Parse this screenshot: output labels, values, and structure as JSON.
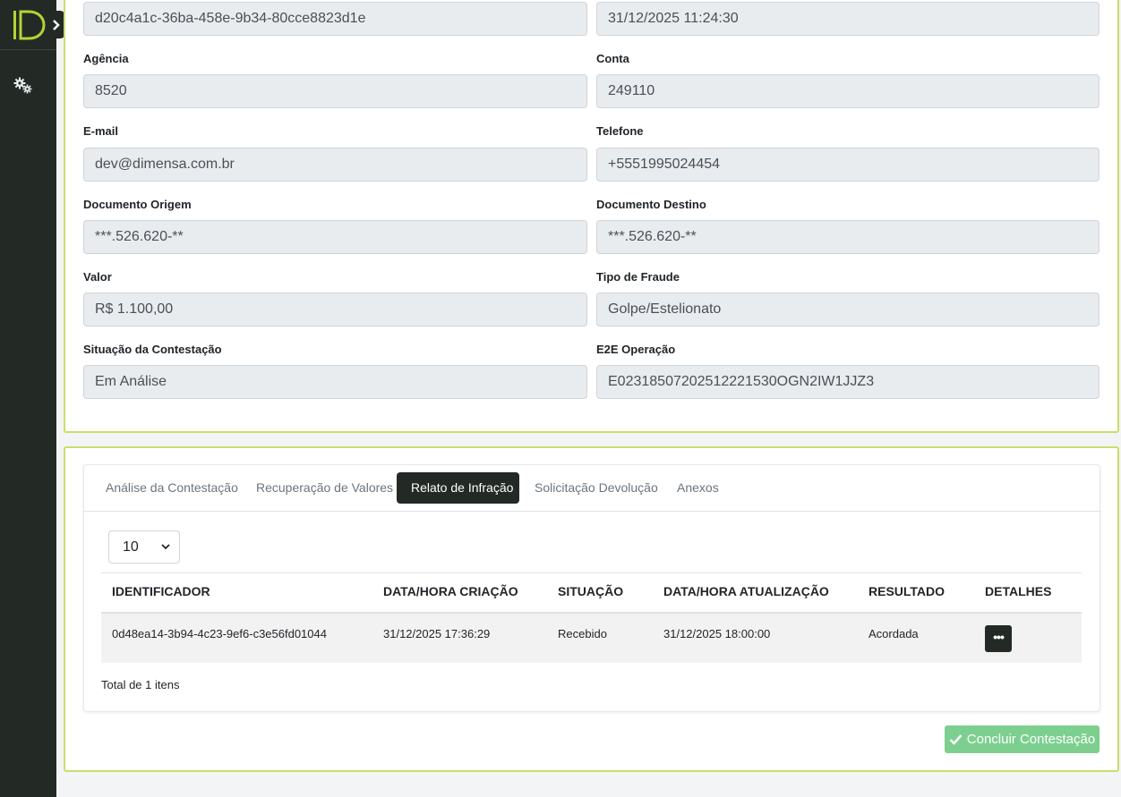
{
  "sidebar": {
    "logo": "D-logo",
    "toggle_icon": "chevron-right-icon",
    "items": [
      {
        "icon": "gears-icon"
      }
    ]
  },
  "contestation": {
    "fields": [
      {
        "id": "identificador",
        "label": "",
        "value": "d20c4a1c-36ba-458e-9b34-80cce8823d1e"
      },
      {
        "id": "data",
        "label": "",
        "value": "31/12/2025 11:24:30"
      },
      {
        "id": "agencia",
        "label": "Agência",
        "value": "8520"
      },
      {
        "id": "conta",
        "label": "Conta",
        "value": "249110"
      },
      {
        "id": "email",
        "label": "E-mail",
        "value": "dev@dimensa.com.br"
      },
      {
        "id": "telefone",
        "label": "Telefone",
        "value": "+5551995024454"
      },
      {
        "id": "doc_origem",
        "label": "Documento Origem",
        "value": "***.526.620-**"
      },
      {
        "id": "doc_destino",
        "label": "Documento Destino",
        "value": "***.526.620-**"
      },
      {
        "id": "valor",
        "label": "Valor",
        "value": "R$ 1.100,00"
      },
      {
        "id": "tipo_fraude",
        "label": "Tipo de Fraude",
        "value": "Golpe/Estelionato"
      },
      {
        "id": "situacao",
        "label": "Situação da Contestação",
        "value": "Em Análise"
      },
      {
        "id": "e2e",
        "label": "E2E Operação",
        "value": "E02318507202512221530OGN2IW1JJZ3"
      }
    ]
  },
  "tabs": [
    {
      "label": "Análise da Contestação",
      "active": false
    },
    {
      "label": "Recuperação de Valores",
      "active": false
    },
    {
      "label": "Relato de Infração",
      "active": true
    },
    {
      "label": "Solicitação Devolução",
      "active": false
    },
    {
      "label": "Anexos",
      "active": false
    }
  ],
  "page_size": {
    "selected": "10"
  },
  "table": {
    "headers": [
      "IDENTIFICADOR",
      "DATA/HORA CRIAÇÃO",
      "SITUAÇÃO",
      "DATA/HORA ATUALIZAÇÃO",
      "RESULTADO",
      "DETALHES"
    ],
    "rows": [
      [
        "0d48ea14-3b94-4c23-9ef6-c3e56fd01044",
        "31/12/2025 17:36:29",
        "Recebido",
        "31/12/2025 18:00:00",
        "Acordada",
        "..."
      ]
    ],
    "details_button": "•••"
  },
  "total_text": "Total de 1 itens",
  "actions": {
    "conclude_label": "Concluir Contestação",
    "conclude_icon": "check-icon"
  },
  "colors": {
    "sidebar": "#232a26",
    "accent_border": "#c7e06a",
    "logo": "#b5d334",
    "conclude": "#7dcf8f"
  }
}
